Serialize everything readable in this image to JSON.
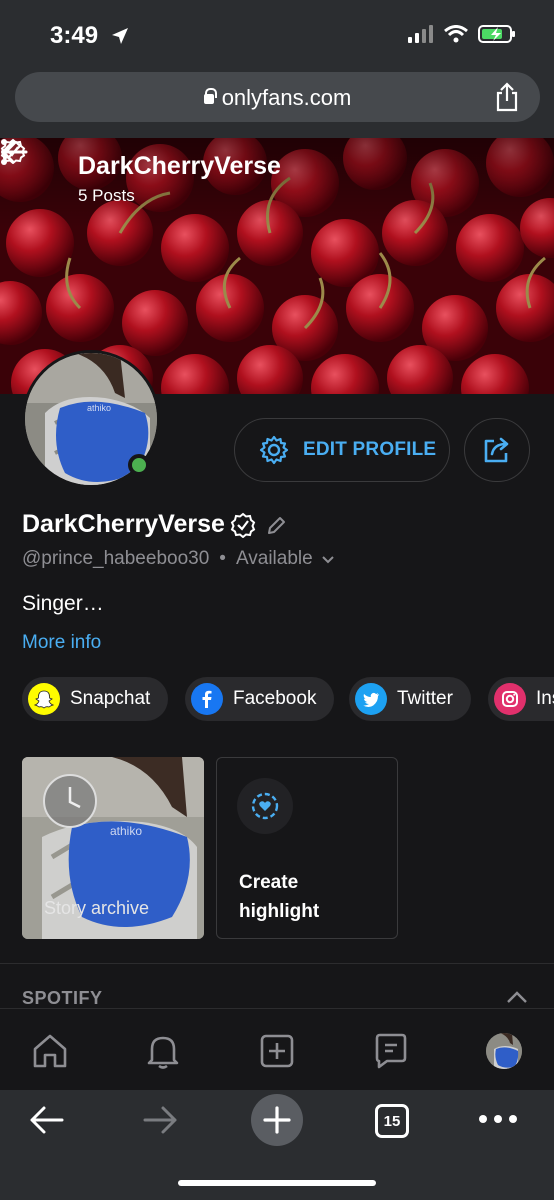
{
  "status_bar": {
    "time": "3:49"
  },
  "browser": {
    "url": "onlyfans.com"
  },
  "cover": {
    "title": "DarkCherryVerse",
    "posts": "5 Posts"
  },
  "profile": {
    "edit_label": "EDIT PROFILE",
    "name": "DarkCherryVerse",
    "handle": "@prince_habeeboo30",
    "separator": "•",
    "status": "Available",
    "bio": "Singer…",
    "more_info": "More info"
  },
  "socials": [
    {
      "label": "Snapchat",
      "color": "#fffc00"
    },
    {
      "label": "Facebook",
      "color": "#1877f2"
    },
    {
      "label": "Twitter",
      "color": "#1da1f2"
    },
    {
      "label": "Ins",
      "color": "#e1306c"
    }
  ],
  "highlights": {
    "story_archive": "Story archive",
    "create_line1": "Create",
    "create_line2": "highlight"
  },
  "sections": {
    "spotify": "SPOTIFY"
  },
  "tabbar": [
    "home-icon",
    "bell-icon",
    "add-post-icon",
    "messages-icon",
    "avatar"
  ],
  "safari": {
    "tab_count": "15"
  },
  "colors": {
    "accent": "#4aaef2",
    "online": "#4caf50",
    "background": "#161618"
  }
}
